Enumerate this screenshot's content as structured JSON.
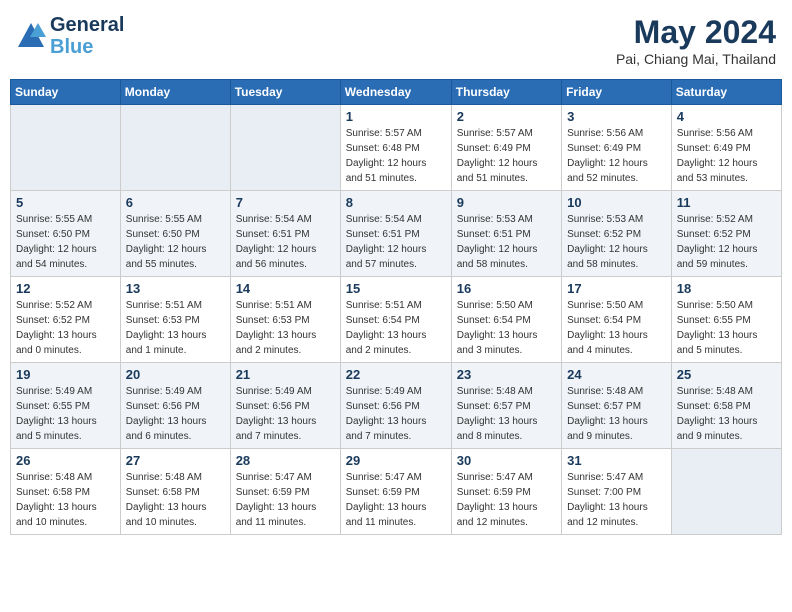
{
  "app": {
    "logo_line1": "General",
    "logo_line2": "Blue"
  },
  "header": {
    "title": "May 2024",
    "subtitle": "Pai, Chiang Mai, Thailand"
  },
  "days_of_week": [
    "Sunday",
    "Monday",
    "Tuesday",
    "Wednesday",
    "Thursday",
    "Friday",
    "Saturday"
  ],
  "weeks": [
    [
      {
        "day": "",
        "sunrise": "",
        "sunset": "",
        "daylight": ""
      },
      {
        "day": "",
        "sunrise": "",
        "sunset": "",
        "daylight": ""
      },
      {
        "day": "",
        "sunrise": "",
        "sunset": "",
        "daylight": ""
      },
      {
        "day": "1",
        "sunrise": "Sunrise: 5:57 AM",
        "sunset": "Sunset: 6:48 PM",
        "daylight": "Daylight: 12 hours and 51 minutes."
      },
      {
        "day": "2",
        "sunrise": "Sunrise: 5:57 AM",
        "sunset": "Sunset: 6:49 PM",
        "daylight": "Daylight: 12 hours and 51 minutes."
      },
      {
        "day": "3",
        "sunrise": "Sunrise: 5:56 AM",
        "sunset": "Sunset: 6:49 PM",
        "daylight": "Daylight: 12 hours and 52 minutes."
      },
      {
        "day": "4",
        "sunrise": "Sunrise: 5:56 AM",
        "sunset": "Sunset: 6:49 PM",
        "daylight": "Daylight: 12 hours and 53 minutes."
      }
    ],
    [
      {
        "day": "5",
        "sunrise": "Sunrise: 5:55 AM",
        "sunset": "Sunset: 6:50 PM",
        "daylight": "Daylight: 12 hours and 54 minutes."
      },
      {
        "day": "6",
        "sunrise": "Sunrise: 5:55 AM",
        "sunset": "Sunset: 6:50 PM",
        "daylight": "Daylight: 12 hours and 55 minutes."
      },
      {
        "day": "7",
        "sunrise": "Sunrise: 5:54 AM",
        "sunset": "Sunset: 6:51 PM",
        "daylight": "Daylight: 12 hours and 56 minutes."
      },
      {
        "day": "8",
        "sunrise": "Sunrise: 5:54 AM",
        "sunset": "Sunset: 6:51 PM",
        "daylight": "Daylight: 12 hours and 57 minutes."
      },
      {
        "day": "9",
        "sunrise": "Sunrise: 5:53 AM",
        "sunset": "Sunset: 6:51 PM",
        "daylight": "Daylight: 12 hours and 58 minutes."
      },
      {
        "day": "10",
        "sunrise": "Sunrise: 5:53 AM",
        "sunset": "Sunset: 6:52 PM",
        "daylight": "Daylight: 12 hours and 58 minutes."
      },
      {
        "day": "11",
        "sunrise": "Sunrise: 5:52 AM",
        "sunset": "Sunset: 6:52 PM",
        "daylight": "Daylight: 12 hours and 59 minutes."
      }
    ],
    [
      {
        "day": "12",
        "sunrise": "Sunrise: 5:52 AM",
        "sunset": "Sunset: 6:52 PM",
        "daylight": "Daylight: 13 hours and 0 minutes."
      },
      {
        "day": "13",
        "sunrise": "Sunrise: 5:51 AM",
        "sunset": "Sunset: 6:53 PM",
        "daylight": "Daylight: 13 hours and 1 minute."
      },
      {
        "day": "14",
        "sunrise": "Sunrise: 5:51 AM",
        "sunset": "Sunset: 6:53 PM",
        "daylight": "Daylight: 13 hours and 2 minutes."
      },
      {
        "day": "15",
        "sunrise": "Sunrise: 5:51 AM",
        "sunset": "Sunset: 6:54 PM",
        "daylight": "Daylight: 13 hours and 2 minutes."
      },
      {
        "day": "16",
        "sunrise": "Sunrise: 5:50 AM",
        "sunset": "Sunset: 6:54 PM",
        "daylight": "Daylight: 13 hours and 3 minutes."
      },
      {
        "day": "17",
        "sunrise": "Sunrise: 5:50 AM",
        "sunset": "Sunset: 6:54 PM",
        "daylight": "Daylight: 13 hours and 4 minutes."
      },
      {
        "day": "18",
        "sunrise": "Sunrise: 5:50 AM",
        "sunset": "Sunset: 6:55 PM",
        "daylight": "Daylight: 13 hours and 5 minutes."
      }
    ],
    [
      {
        "day": "19",
        "sunrise": "Sunrise: 5:49 AM",
        "sunset": "Sunset: 6:55 PM",
        "daylight": "Daylight: 13 hours and 5 minutes."
      },
      {
        "day": "20",
        "sunrise": "Sunrise: 5:49 AM",
        "sunset": "Sunset: 6:56 PM",
        "daylight": "Daylight: 13 hours and 6 minutes."
      },
      {
        "day": "21",
        "sunrise": "Sunrise: 5:49 AM",
        "sunset": "Sunset: 6:56 PM",
        "daylight": "Daylight: 13 hours and 7 minutes."
      },
      {
        "day": "22",
        "sunrise": "Sunrise: 5:49 AM",
        "sunset": "Sunset: 6:56 PM",
        "daylight": "Daylight: 13 hours and 7 minutes."
      },
      {
        "day": "23",
        "sunrise": "Sunrise: 5:48 AM",
        "sunset": "Sunset: 6:57 PM",
        "daylight": "Daylight: 13 hours and 8 minutes."
      },
      {
        "day": "24",
        "sunrise": "Sunrise: 5:48 AM",
        "sunset": "Sunset: 6:57 PM",
        "daylight": "Daylight: 13 hours and 9 minutes."
      },
      {
        "day": "25",
        "sunrise": "Sunrise: 5:48 AM",
        "sunset": "Sunset: 6:58 PM",
        "daylight": "Daylight: 13 hours and 9 minutes."
      }
    ],
    [
      {
        "day": "26",
        "sunrise": "Sunrise: 5:48 AM",
        "sunset": "Sunset: 6:58 PM",
        "daylight": "Daylight: 13 hours and 10 minutes."
      },
      {
        "day": "27",
        "sunrise": "Sunrise: 5:48 AM",
        "sunset": "Sunset: 6:58 PM",
        "daylight": "Daylight: 13 hours and 10 minutes."
      },
      {
        "day": "28",
        "sunrise": "Sunrise: 5:47 AM",
        "sunset": "Sunset: 6:59 PM",
        "daylight": "Daylight: 13 hours and 11 minutes."
      },
      {
        "day": "29",
        "sunrise": "Sunrise: 5:47 AM",
        "sunset": "Sunset: 6:59 PM",
        "daylight": "Daylight: 13 hours and 11 minutes."
      },
      {
        "day": "30",
        "sunrise": "Sunrise: 5:47 AM",
        "sunset": "Sunset: 6:59 PM",
        "daylight": "Daylight: 13 hours and 12 minutes."
      },
      {
        "day": "31",
        "sunrise": "Sunrise: 5:47 AM",
        "sunset": "Sunset: 7:00 PM",
        "daylight": "Daylight: 13 hours and 12 minutes."
      },
      {
        "day": "",
        "sunrise": "",
        "sunset": "",
        "daylight": ""
      }
    ]
  ]
}
